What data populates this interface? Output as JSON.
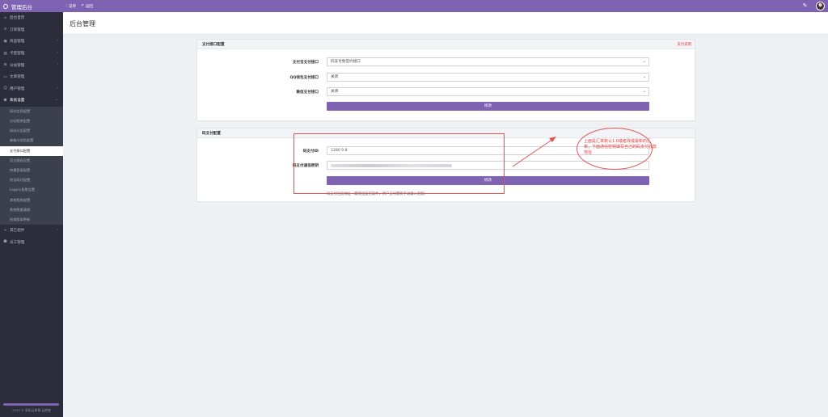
{
  "topbar": {
    "brand": "管理后台",
    "actions": [
      {
        "label": "菜单"
      },
      {
        "label": "返回"
      }
    ]
  },
  "sidebar": {
    "items": [
      {
        "label": "后台首页",
        "icon": "home-icon"
      },
      {
        "label": "订单管理",
        "icon": "list-icon"
      },
      {
        "label": "商品管理",
        "icon": "cube-icon"
      },
      {
        "label": "卡密管理",
        "icon": "card-icon"
      },
      {
        "label": "分站管理",
        "icon": "sitemap-icon"
      },
      {
        "label": "文章管理",
        "icon": "file-icon"
      },
      {
        "label": "用户管理",
        "icon": "users-icon"
      },
      {
        "label": "系统设置",
        "icon": "gear-icon"
      }
    ],
    "submenu": [
      "网站信息配置",
      "分站相关配置",
      "网站公告配置",
      "邮箱与短信配置",
      "支付接口配置",
      "官方版权设置",
      "快捷登录配置",
      "验证码开配置",
      "Logo与背景设置",
      "其他相关配置",
      "系统数据清理",
      "检查版本更新"
    ],
    "after": [
      {
        "label": "其它组件",
        "icon": "puzzle-icon"
      },
      {
        "label": "员工管理",
        "icon": "user-icon"
      }
    ],
    "footer": "2022 © 彩虹云商城 云商城"
  },
  "header": {
    "title": "后台管理"
  },
  "pay_card": {
    "title": "支付接口配置",
    "link": "支付说明",
    "rows": [
      {
        "label": "支付宝支付接口",
        "value": "码支付免签约接口"
      },
      {
        "label": "QQ钱包支付接口",
        "value": "关闭"
      },
      {
        "label": "微信支付接口",
        "value": "关闭"
      }
    ],
    "save": "修改"
  },
  "codepay_card": {
    "title": "码支付配置",
    "id_label": "码支付ID",
    "id_value": "1280 9 8",
    "key_label": "码支付通信密钥",
    "save": "修改",
    "hint": "码支付注册地址（需要挂监控软件，用户支付需要手动输入金额）"
  },
  "annotation": {
    "text": "上面是汇率默认1.0或者改成最新的汇率，下面通信密钥填写自己的码支付收款地址"
  }
}
